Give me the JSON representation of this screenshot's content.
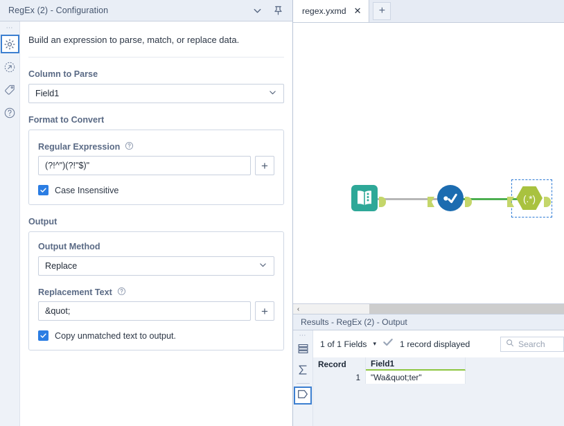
{
  "config_panel": {
    "title": "RegEx (2) - Configuration",
    "titlebar_icons": [
      {
        "name": "chevron-down-icon"
      },
      {
        "name": "pin-icon"
      }
    ],
    "rail_icons": [
      {
        "name": "gear-icon",
        "selected": true
      },
      {
        "name": "arrow-circle-icon",
        "selected": false
      },
      {
        "name": "tag-icon",
        "selected": false
      },
      {
        "name": "question-circle-icon",
        "selected": false
      }
    ],
    "intro": "Build an expression to parse, match, or replace data.",
    "column_to_parse": {
      "label": "Column to Parse",
      "value": "Field1"
    },
    "format_to_convert": {
      "label": "Format to Convert",
      "regular_expression": {
        "label": "Regular Expression",
        "value": "(?!^\")(?!\"$)\"",
        "add_button": "+"
      },
      "case_insensitive": {
        "label": "Case Insensitive",
        "checked": true
      }
    },
    "output": {
      "label": "Output",
      "output_method": {
        "label": "Output Method",
        "value": "Replace"
      },
      "replacement_text": {
        "label": "Replacement Text",
        "value": "&quot;",
        "add_button": "+"
      },
      "copy_unmatched": {
        "label": "Copy unmatched text to output.",
        "checked": true
      }
    }
  },
  "tabbar": {
    "document_tab": "regex.yxmd",
    "close_label": "✕",
    "new_tab_label": "+"
  },
  "canvas": {
    "nodes": [
      {
        "name": "input-data-tool",
        "type": "input-data",
        "color": "#2ea898"
      },
      {
        "name": "browse-tool",
        "type": "browse",
        "color": "#1c6cb0"
      },
      {
        "name": "regex-tool",
        "type": "regex",
        "label": "(.*)",
        "color": "#a9c23f",
        "selected": true
      }
    ],
    "connections": [
      {
        "name": "connection-input-to-browse",
        "color": "#b6b6b6"
      },
      {
        "name": "connection-browse-to-regex",
        "color": "#4caf50"
      }
    ]
  },
  "scrollbar": {
    "left_arrow": "‹"
  },
  "results": {
    "title": "Results - RegEx (2) - Output",
    "rail_icons": [
      {
        "name": "data-grid-icon",
        "selected": false
      },
      {
        "name": "summary-sigma-icon",
        "selected": false
      },
      {
        "name": "metadata-tag-icon",
        "selected": true
      }
    ],
    "toolbar": {
      "fields_label": "1 of 1 Fields",
      "caret": "▾",
      "check": "✓",
      "records_label": "1 record displayed",
      "search_placeholder": "Search"
    },
    "grid": {
      "columns": [
        "Record",
        "Field1"
      ],
      "rows": [
        {
          "record": "1",
          "field1": "\"Wa&quot;ter\""
        }
      ]
    }
  },
  "colors": {
    "accent_blue": "#2b7de3",
    "selection_blue": "#2a78d4",
    "panel_bg": "#f7f9fc",
    "titlebar_bg": "#e9eef6",
    "green_connection": "#4caf50",
    "regex_tool_green": "#a9c23f",
    "input_tool_teal": "#2ea898",
    "browse_tool_blue": "#1c6cb0",
    "field_underline_green": "#8dc63f"
  }
}
